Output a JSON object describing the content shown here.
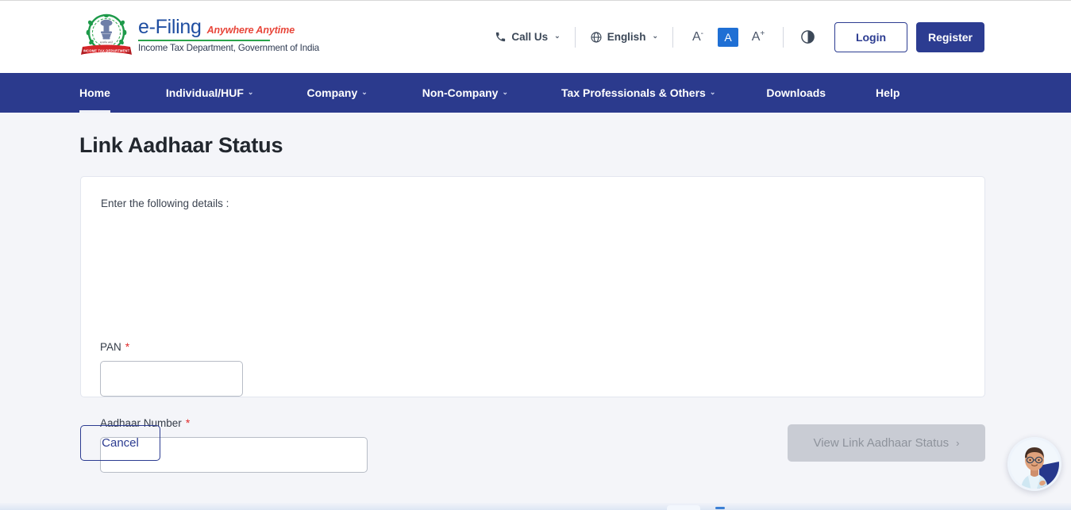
{
  "brand": {
    "emblem_icon": "india-emblem-income-tax-icon",
    "title": "e-Filing",
    "tagline": "Anywhere Anytime",
    "subtitle": "Income Tax Department, Government of India"
  },
  "header": {
    "call_us": {
      "label": "Call Us",
      "icon": "phone-icon",
      "chevron": "⌄"
    },
    "language": {
      "label": "English",
      "icon": "globe-icon",
      "chevron": "⌄"
    },
    "font_decrease": {
      "label": "A",
      "sup": "-",
      "icon": "font-decrease-icon"
    },
    "font_normal": {
      "label": "A",
      "icon": "font-normal-icon"
    },
    "font_increase": {
      "label": "A",
      "sup": "+",
      "icon": "font-increase-icon"
    },
    "contrast": {
      "icon": "contrast-toggle-icon"
    },
    "login_label": "Login",
    "register_label": "Register",
    "accent_color": "#2c3c91",
    "highlight_color": "#1f6fd4"
  },
  "nav": {
    "bar_color": "#2b3a8d",
    "items": [
      {
        "label": "Home",
        "has_dropdown": false,
        "active": true
      },
      {
        "label": "Individual/HUF",
        "has_dropdown": true,
        "active": false
      },
      {
        "label": "Company",
        "has_dropdown": true,
        "active": false
      },
      {
        "label": "Non-Company",
        "has_dropdown": true,
        "active": false
      },
      {
        "label": "Tax Professionals & Others",
        "has_dropdown": true,
        "active": false
      },
      {
        "label": "Downloads",
        "has_dropdown": false,
        "active": false
      },
      {
        "label": "Help",
        "has_dropdown": false,
        "active": false
      }
    ]
  },
  "main": {
    "page_title": "Link Aadhaar Status",
    "card": {
      "intro": "Enter the following details :",
      "fields": [
        {
          "label": "PAN",
          "required_mark": "*",
          "value": "",
          "placeholder": ""
        },
        {
          "label": "Aadhaar Number",
          "required_mark": "*",
          "value": "",
          "placeholder": ""
        }
      ]
    },
    "cancel_label": "Cancel",
    "submit_label": "View Link Aadhaar Status",
    "submit_arrow": "›",
    "submit_disabled": true
  },
  "chat": {
    "icon": "chat-support-avatar-icon"
  }
}
